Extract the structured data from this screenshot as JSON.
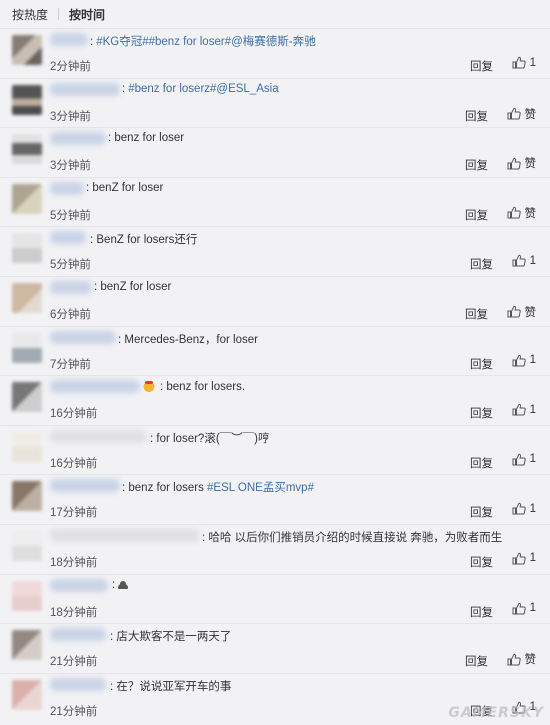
{
  "sort": {
    "hot": "按热度",
    "time": "按时间"
  },
  "comments": [
    {
      "text_tag": "#KG夺冠##benz for loser#@梅赛德斯-奔驰",
      "time": "2分钟前",
      "reply": "回复",
      "like": "1"
    },
    {
      "text_tag": "#benz for loserz#@ESL_Asia",
      "time": "3分钟前",
      "reply": "回复",
      "like": "赞"
    },
    {
      "text": "benz for loser",
      "time": "3分钟前",
      "reply": "回复",
      "like": "赞"
    },
    {
      "text": "benZ for loser",
      "time": "5分钟前",
      "reply": "回复",
      "like": "赞"
    },
    {
      "text": "BenZ for losers还行",
      "time": "5分钟前",
      "reply": "回复",
      "like": "1"
    },
    {
      "text": "benZ for loser",
      "time": "6分钟前",
      "reply": "回复",
      "like": "赞"
    },
    {
      "text": "Mercedes-Benz，for loser",
      "time": "7分钟前",
      "reply": "回复",
      "like": "1"
    },
    {
      "text": "benz for losers.",
      "time": "16分钟前",
      "reply": "回复",
      "like": "1"
    },
    {
      "text": "for loser?滚(￣︶￣)哼",
      "time": "16分钟前",
      "reply": "回复",
      "like": "1"
    },
    {
      "text": "benz for losers",
      "tag": "#ESL ONE孟买mvp#",
      "time": "17分钟前",
      "reply": "回复",
      "like": "1"
    },
    {
      "text": "哈哈 以后你们推销员介绍的时候直接说 奔驰，为败者而生",
      "time": "18分钟前",
      "reply": "回复",
      "like": "1"
    },
    {
      "text": "",
      "time": "18分钟前",
      "reply": "回复",
      "like": "1"
    },
    {
      "text": "店大欺客不是一两天了",
      "time": "21分钟前",
      "reply": "回复",
      "like": "赞"
    },
    {
      "text": "在？说说亚军开车的事",
      "time": "21分钟前",
      "reply": "回复",
      "like": "1"
    }
  ],
  "watermark": "GAMERSKY",
  "icons": {
    "like": "thumbs-up-icon",
    "emoji": "crown-emoji-icon",
    "poop": "poop-emoji-icon"
  }
}
